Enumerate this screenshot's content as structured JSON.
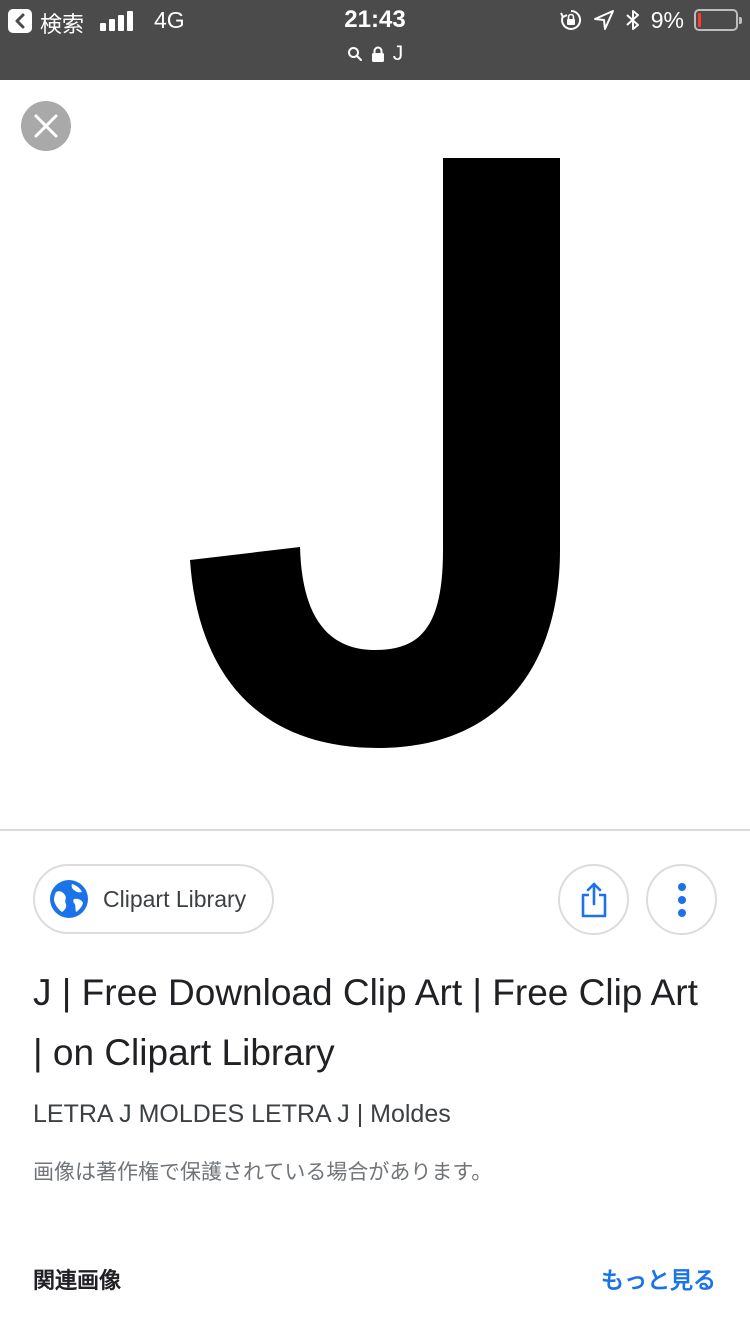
{
  "status_bar": {
    "back_label": "検索",
    "network": "4G",
    "time": "21:43",
    "battery_percent": "9%",
    "battery_level": 0.09,
    "url_text": "J",
    "background_color": "#4b4b4b",
    "battery_low_color": "#ff3b30"
  },
  "image_viewer": {
    "close_icon": "close-icon",
    "image_letter": "J"
  },
  "source": {
    "site_name": "Clipart Library",
    "site_icon": "globe-icon",
    "share_icon": "share-icon",
    "more_icon": "more-vert-icon",
    "accent_color": "#1a73e8"
  },
  "result": {
    "title": "J | Free Download Clip Art | Free Clip Art | on Clipart Library",
    "subtitle": "LETRA J MOLDES LETRA J | Moldes",
    "copyright_notice": "画像は著作権で保護されている場合があります。"
  },
  "related": {
    "label": "関連画像",
    "more_link": "もっと見る"
  }
}
